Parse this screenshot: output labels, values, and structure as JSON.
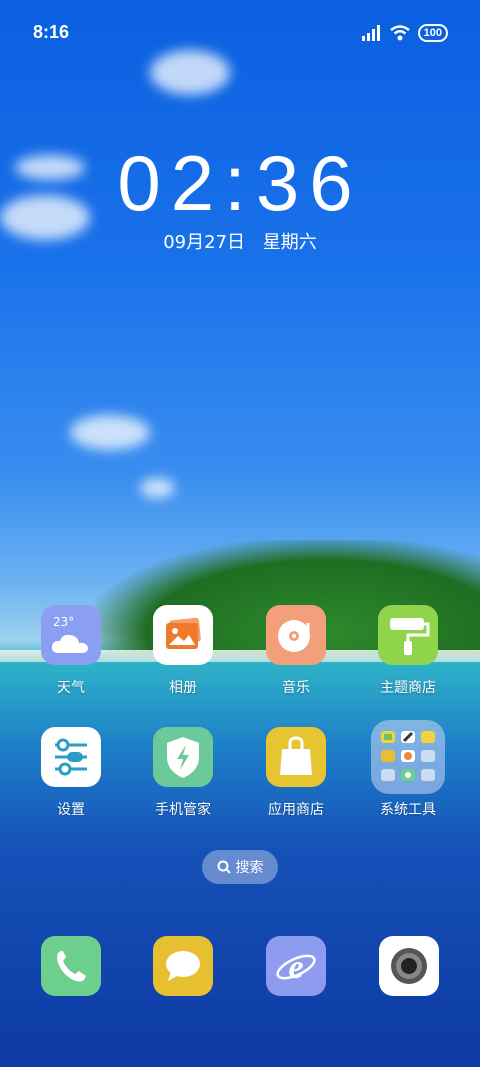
{
  "status": {
    "time": "8:16",
    "battery": "100"
  },
  "clock": {
    "time": "02:36",
    "date": "09月27日",
    "weekday": "星期六"
  },
  "apps": [
    {
      "label": "天气",
      "temp": "23°",
      "color": "#8a9ff2"
    },
    {
      "label": "相册",
      "color": "#ffffff"
    },
    {
      "label": "音乐",
      "color": "#f3a07a"
    },
    {
      "label": "主题商店",
      "color": "#8fd44a"
    },
    {
      "label": "设置",
      "color": "#ffffff"
    },
    {
      "label": "手机管家",
      "color": "#6cc99a"
    },
    {
      "label": "应用商店",
      "color": "#e7c531"
    },
    {
      "label": "系统工具",
      "color": "rgba(200,215,245,0.7)"
    }
  ],
  "search": {
    "label": "搜索"
  },
  "dock": [
    {
      "name": "phone",
      "color": "#6ccf8e"
    },
    {
      "name": "messages",
      "color": "#e6c030"
    },
    {
      "name": "browser",
      "color": "#8e9cf0"
    },
    {
      "name": "camera",
      "color": "#ffffff"
    }
  ]
}
